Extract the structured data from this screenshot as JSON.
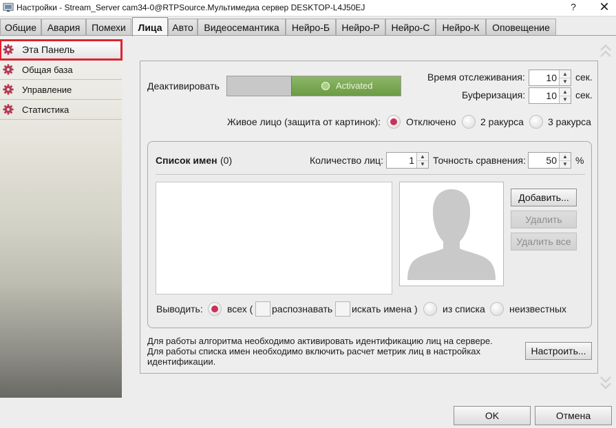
{
  "window": {
    "title": "Настройки - Stream_Server cam34-0@RTPSource.Мультимедиа сервер DESKTOP-L4J50EJ",
    "help": "?",
    "close": "✕"
  },
  "tabs": [
    {
      "label": "Общие"
    },
    {
      "label": "Авария"
    },
    {
      "label": "Помехи"
    },
    {
      "label": "Лица"
    },
    {
      "label": "Авто"
    },
    {
      "label": "Видеосемантика"
    },
    {
      "label": "Нейро-Б"
    },
    {
      "label": "Нейро-Р"
    },
    {
      "label": "Нейро-С"
    },
    {
      "label": "Нейро-К"
    },
    {
      "label": "Оповещение"
    }
  ],
  "active_tab": "Лица",
  "sidebar": {
    "items": [
      {
        "label": "Эта Панель",
        "icon": "gear-icon"
      },
      {
        "label": "Общая база",
        "icon": "gear-icon"
      },
      {
        "label": "Управление",
        "icon": "gear-icon"
      },
      {
        "label": "Статистика",
        "icon": "gear-icon"
      }
    ],
    "selected": "Эта Панель"
  },
  "main": {
    "deactivate_label": "Деактивировать",
    "toggle_text": "Activated",
    "tracking_time": {
      "label": "Время отслеживания:",
      "value": "10",
      "unit": "сек."
    },
    "buffering": {
      "label": "Буферизация:",
      "value": "10",
      "unit": "сек."
    },
    "live_face": {
      "label": "Живое лицо (защита от картинок):",
      "options": [
        "Отключено",
        "2 ракурса",
        "3 ракурса"
      ],
      "selected": "Отключено"
    },
    "names_list": {
      "title": "Список имен",
      "count": "(0)",
      "faces_count": {
        "label": "Количество лиц:",
        "value": "1"
      },
      "accuracy": {
        "label": "Точность сравнения:",
        "value": "50",
        "unit": "%"
      }
    },
    "buttons": {
      "add": "Добавить...",
      "delete": "Удалить",
      "delete_all": "Удалить все"
    },
    "output": {
      "label": "Выводить:",
      "all": "всех (",
      "recognize": "распознавать",
      "search_names": "искать имена )",
      "from_list": "из списка",
      "unknown": "неизвестных",
      "selected": "всех"
    },
    "note_line1": "Для работы алгоритма необходимо активировать идентификацию лиц на сервере.",
    "note_line2": "Для работы списка имен необходимо включить расчет метрик лиц в настройках идентификации.",
    "configure_button": "Настроить..."
  },
  "footer": {
    "ok": "OK",
    "cancel": "Отмена"
  },
  "colors": {
    "accent_radio": "#c8325a",
    "toggle_on": "#7aa854",
    "selection_outline": "#e0222e"
  }
}
